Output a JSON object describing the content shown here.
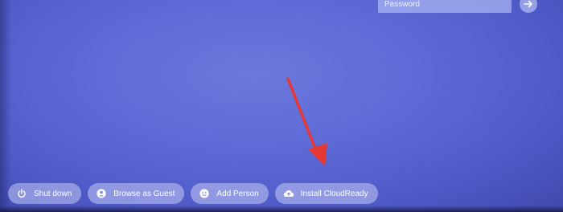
{
  "login": {
    "password_placeholder": "Password",
    "submit_icon": "arrow-right-icon"
  },
  "shelf": {
    "buttons": [
      {
        "label": "Shut down",
        "icon": "power-icon"
      },
      {
        "label": "Browse as Guest",
        "icon": "guest-person-icon"
      },
      {
        "label": "Add Person",
        "icon": "add-person-icon"
      },
      {
        "label": "Install CloudReady",
        "icon": "cloud-upload-icon"
      }
    ]
  },
  "annotation": {
    "arrow_color": "#e53935"
  },
  "colors": {
    "background": "#5d6ad6",
    "pill": "#cdd4fa",
    "text": "#ffffff"
  }
}
